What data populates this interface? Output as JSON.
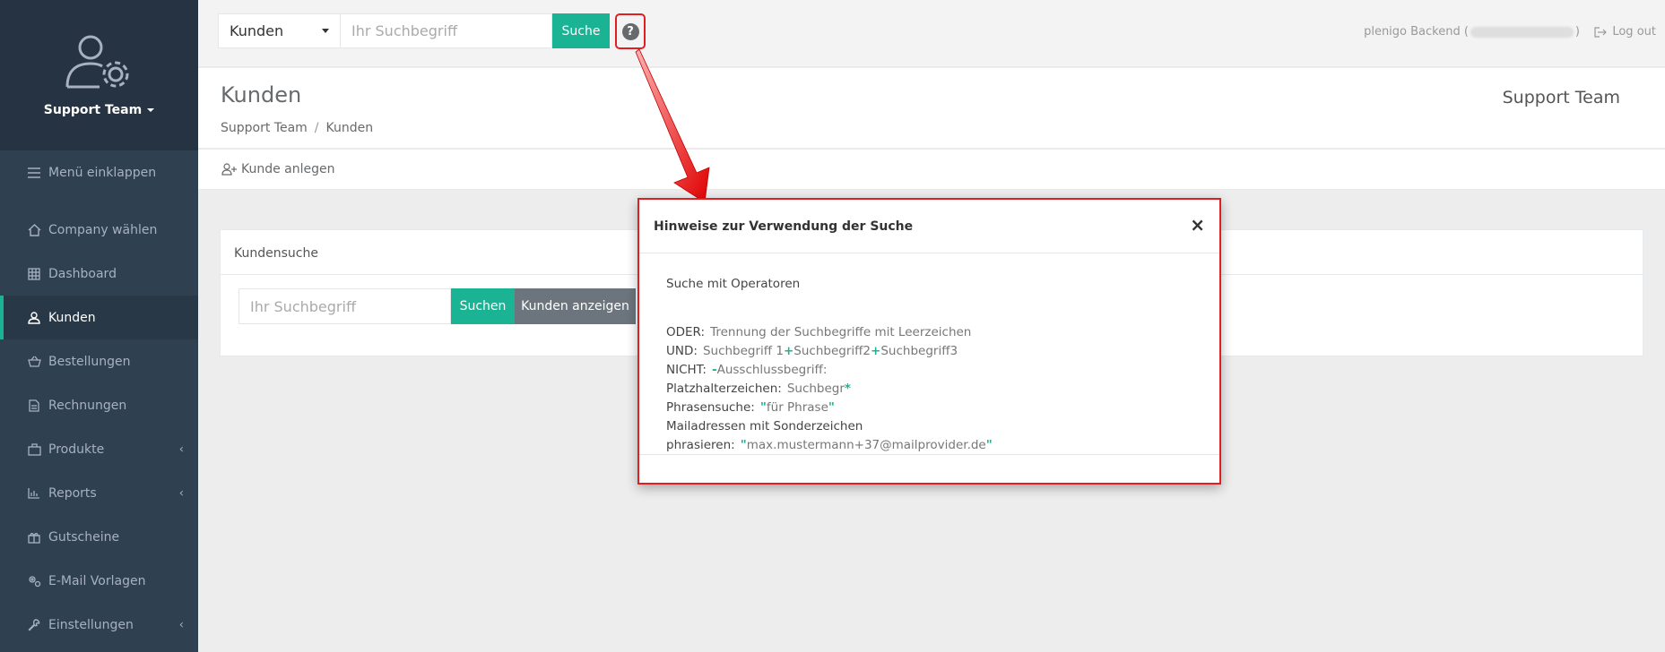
{
  "sidebar": {
    "team_name": "Support Team",
    "items": [
      {
        "label": "Menü einklappen",
        "icon": "menu-icon"
      },
      {
        "label": "Company wählen",
        "icon": "home-icon"
      },
      {
        "label": "Dashboard",
        "icon": "grid-icon"
      },
      {
        "label": "Kunden",
        "icon": "user-icon",
        "active": true
      },
      {
        "label": "Bestellungen",
        "icon": "basket-icon"
      },
      {
        "label": "Rechnungen",
        "icon": "invoice-icon"
      },
      {
        "label": "Produkte",
        "icon": "product-icon",
        "has_submenu": true
      },
      {
        "label": "Reports",
        "icon": "chart-icon",
        "has_submenu": true
      },
      {
        "label": "Gutscheine",
        "icon": "gift-icon"
      },
      {
        "label": "E-Mail Vorlagen",
        "icon": "cogs-icon"
      },
      {
        "label": "Einstellungen",
        "icon": "wrench-icon",
        "has_submenu": true
      }
    ]
  },
  "topbar": {
    "scope_value": "Kunden",
    "search_placeholder": "Ihr Suchbegriff",
    "search_button": "Suche",
    "help_icon": "?",
    "user_prefix": "plenigo Backend (",
    "user_suffix": ")",
    "logout": "Log out"
  },
  "heading": {
    "title": "Kunden",
    "breadcrumb": [
      "Support Team",
      "/",
      "Kunden"
    ],
    "team_label": "Support Team"
  },
  "actions": {
    "add_customer": "Kunde anlegen"
  },
  "panel": {
    "title": "Kundensuche",
    "search_placeholder": "Ihr Suchbegriff",
    "search_button": "Suchen",
    "show_button": "Kunden anzeigen"
  },
  "modal": {
    "title": "Hinweise zur Verwendung der Suche",
    "close": "×",
    "subtitle": "Suche mit Operatoren",
    "rows": {
      "oder_key": "ODER:",
      "oder_val": "Trennung der Suchbegriffe mit Leerzeichen",
      "und_key": "UND:",
      "und_term1": "Suchbegriff 1",
      "und_op": "+",
      "und_term2": "Suchbegriff2",
      "und_term3": "Suchbegriff3",
      "nicht_key": "NICHT:",
      "nicht_op": "-",
      "nicht_val": "Ausschlussbegriff:",
      "platz_key": "Platzhalterzeichen:",
      "platz_val": "Suchbegr",
      "platz_op": "*",
      "phrase_key": "Phrasensuche:",
      "phrase_op": "\"",
      "phrase_val": "für Phrase",
      "mail_key": "Mailadressen mit Sonderzeichen phrasieren:",
      "mail_val": "max.mustermann+37@mailprovider.de"
    }
  },
  "colors": {
    "accent": "#1ab394",
    "sidebar": "#2f4050",
    "highlight": "#e02020"
  }
}
